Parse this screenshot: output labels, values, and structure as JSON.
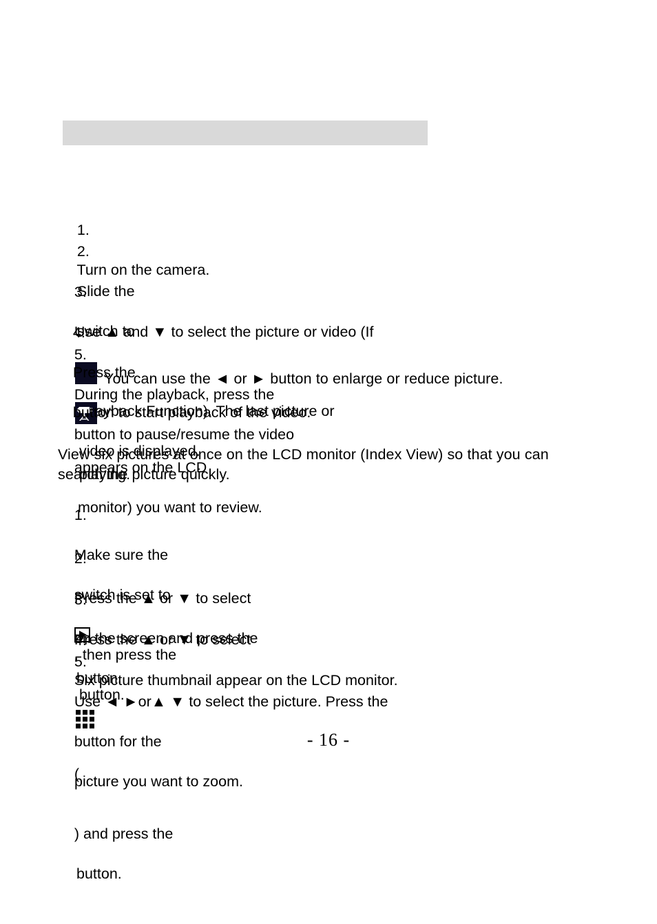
{
  "page": {
    "number_label": "- 16 -",
    "header_bar": {
      "text": "",
      "background": "#d9d9d9"
    }
  },
  "colors": {
    "text": "#000000",
    "header_bar": "#d9d9d9",
    "video_icon_bg": "#0b0b22",
    "video_icon_fg": "#ffffff",
    "page_background": "#ffffff"
  },
  "section_playback": {
    "heading": "",
    "steps": [
      {
        "number": "1.",
        "line1_a": "Turn on the camera.",
        "line1_b": "",
        "line2": ""
      },
      {
        "number": "2.",
        "line1_a": "Slide the",
        "line1_b": "switch to",
        "line1_c": "(Playback Function). The last picture or",
        "line2": "video is displayed."
      },
      {
        "number": "3.",
        "line1_a": "Use ▲ and ▼ to select the picture or video (If",
        "line1_b": "appears on the LCD",
        "line2": "monitor) you want to review."
      },
      {
        "number": "4.",
        "line1_a": "Press the",
        "line1_b": "button to start playback of the video.",
        "line2": ""
      },
      {
        "number": "5.",
        "line1_a": "During the playback, press the",
        "line1_b": "button to pause/resume the video",
        "line2": "playing."
      }
    ],
    "note": "You can use the ◄ or ► button to enlarge or reduce picture."
  },
  "section_index_view": {
    "heading": "",
    "intro_line1": "View six pictures at once on the LCD monitor (Index View) so that you can",
    "intro_line2": "search the picture quickly.",
    "steps": [
      {
        "number": "1.",
        "line1_a": "Make sure the",
        "line1_b": "switch is set to",
        "line1_c": ", then press the",
        "line2": "button."
      },
      {
        "number": "2.",
        "line1_a": "Press the ▲ or ▼ to select",
        "line1_b": "on the screen and press the",
        "line2": "button."
      },
      {
        "number": "3.",
        "line1_a": "Press the ▲ or ▼ to select",
        "line1_b": "(",
        "line1_c": ") and press the",
        "line2": "button."
      },
      {
        "number": "4.",
        "line1_a": "Six picture thumbnail appear on the LCD monitor.",
        "line1_b": "",
        "line2": ""
      },
      {
        "number": "5.",
        "line1_a": "Use ◄ ►or▲ ▼ to select the picture. Press the",
        "line1_b": "button for the",
        "line2": "picture you want to zoom."
      }
    ]
  },
  "icons": {
    "play_button": "play-icon",
    "video_clip": "video-camera-icon",
    "index_grid": "index-grid-icon",
    "arrow_up": "▲",
    "arrow_down": "▼",
    "arrow_left": "◄",
    "arrow_right": "►"
  }
}
